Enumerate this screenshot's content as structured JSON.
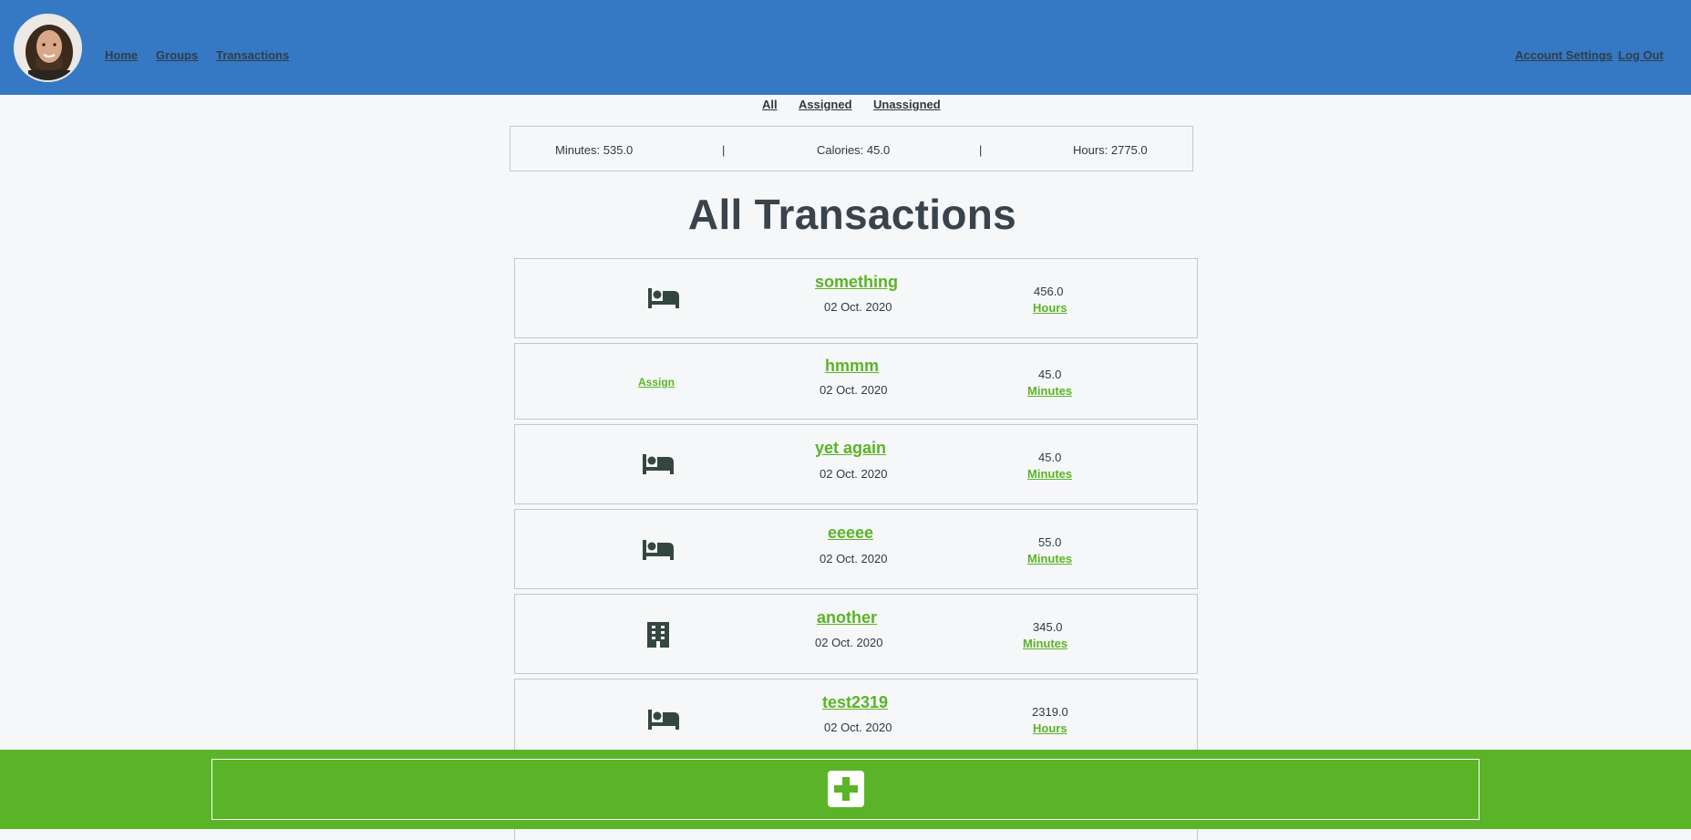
{
  "header": {
    "nav": {
      "home": "Home",
      "groups": "Groups",
      "transactions": "Transactions"
    },
    "account_settings": "Account Settings",
    "log_out": "Log Out"
  },
  "filters": {
    "all": "All",
    "assigned": "Assigned",
    "unassigned": "Unassigned"
  },
  "summary": {
    "minutes": "Minutes: 535.0",
    "separator": "|",
    "calories": "Calories: 45.0",
    "hours": "Hours: 2775.0"
  },
  "page_title": "All Transactions",
  "transactions": [
    {
      "icon": "bed-icon",
      "name": "something",
      "date": "02 Oct. 2020",
      "amount": "456.0",
      "unit": "Hours"
    },
    {
      "icon": null,
      "assign_label": "Assign",
      "name": "hmmm",
      "date": "02 Oct. 2020",
      "amount": "45.0",
      "unit": "Minutes"
    },
    {
      "icon": "bed-icon",
      "name": "yet again",
      "date": "02 Oct. 2020",
      "amount": "45.0",
      "unit": "Minutes"
    },
    {
      "icon": "bed-icon",
      "name": "eeeee",
      "date": "02 Oct. 2020",
      "amount": "55.0",
      "unit": "Minutes"
    },
    {
      "icon": "building-icon",
      "name": "another",
      "date": "02 Oct. 2020",
      "amount": "345.0",
      "unit": "Minutes"
    },
    {
      "icon": "bed-icon",
      "name": "test2319",
      "date": "02 Oct. 2020",
      "amount": "2319.0",
      "unit": "Hours"
    }
  ],
  "footer": {
    "add_icon": "plus-icon"
  },
  "colors": {
    "header": "#3578c4",
    "accent": "#5ab427",
    "background": "#f6f7f8",
    "text": "#2d3a42"
  }
}
